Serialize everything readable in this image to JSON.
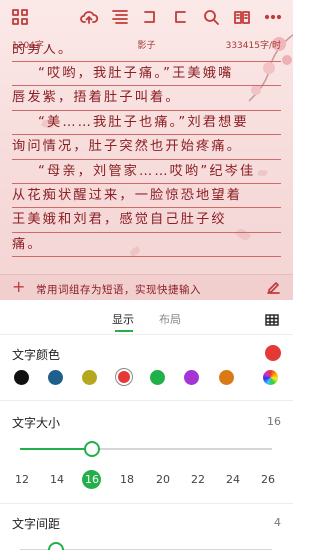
{
  "colors": {
    "accent_red": "#c33a3a",
    "green": "#22b04a",
    "text_color_current": "#e53935"
  },
  "toolbar": {
    "icons": [
      "grid-icon",
      "cloud-upload-icon",
      "format-icon",
      "undo-icon",
      "redo-icon",
      "search-icon",
      "book-icon",
      "more-icon"
    ]
  },
  "info": {
    "word_count": "1204字",
    "chapter_name": "影子",
    "speed": "333415字/时"
  },
  "editor": {
    "lines": [
      "的男人。",
      "“哎哟，我肚子痛。”王美娥嘴",
      "唇发紫，捂着肚子叫着。",
      "“美……我肚子也痛。”刘君想要",
      "询问情况，肚子突然也开始疼痛。",
      "“母亲，刘管家……哎哟”纪岑佳",
      "从花痴状醒过来，一脸惊恐地望着",
      "王美娥和刘君，感觉自己肚子绞",
      "痛。"
    ]
  },
  "quick_bar": {
    "plus_icon": "plus-icon",
    "text": "常用词组存为短语，实现快捷输入",
    "edit_icon": "edit-icon"
  },
  "tabs": [
    {
      "label": "显示",
      "active": true
    },
    {
      "label": "布局",
      "active": false
    }
  ],
  "text_color": {
    "title": "文字颜色",
    "swatches": [
      "#111111",
      "#1f5f8b",
      "#b5a81f",
      "#e53935",
      "#22b04a",
      "#a334d6",
      "#d97a14",
      "rainbow"
    ],
    "selected_index": 3
  },
  "font_size": {
    "title": "文字大小",
    "value": "16",
    "ticks": [
      "12",
      "14",
      "16",
      "18",
      "20",
      "22",
      "24",
      "26"
    ],
    "selected_index": 2
  },
  "letter_spacing": {
    "title": "文字间距",
    "value": "4"
  }
}
